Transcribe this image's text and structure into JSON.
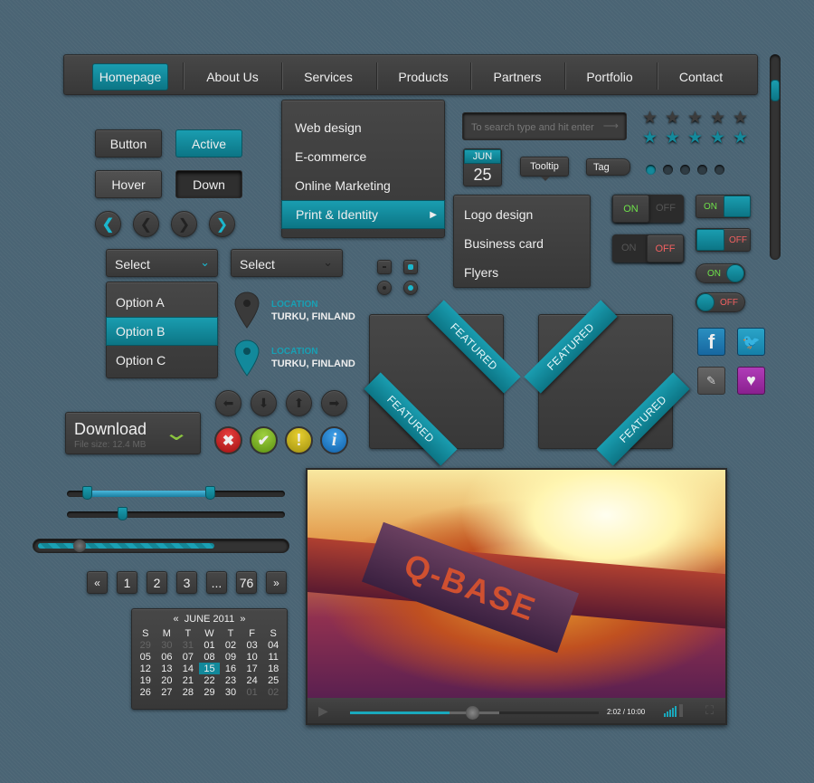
{
  "nav": {
    "items": [
      "Homepage",
      "About Us",
      "Services",
      "Products",
      "Partners",
      "Portfolio",
      "Contact"
    ],
    "active": "Homepage"
  },
  "buttons": {
    "button": "Button",
    "active": "Active",
    "hover": "Hover",
    "down": "Down"
  },
  "selects": [
    {
      "value": "Select"
    },
    {
      "value": "Select"
    }
  ],
  "options": [
    "Option A",
    "Option B",
    "Option C"
  ],
  "locations": [
    {
      "label": "LOCATION",
      "value": "TURKU, FINLAND"
    },
    {
      "label": "LOCATION",
      "value": "TURKU, FINLAND"
    }
  ],
  "menu": {
    "items": [
      "Web design",
      "E-commerce",
      "Online Marketing",
      "Print & Identity"
    ],
    "active": "Print & Identity",
    "submenu": [
      "Logo design",
      "Business card",
      "Flyers"
    ]
  },
  "search": {
    "placeholder": "To search type and hit enter"
  },
  "date": {
    "month": "JUN",
    "day": "25"
  },
  "tooltip": "Tooltip",
  "tag": "Tag",
  "toggles": {
    "on": "ON",
    "off": "OFF"
  },
  "featured": "FEATURED",
  "download": {
    "label": "Download",
    "size": "File size: 12.4 MB"
  },
  "pagination": [
    "«",
    "1",
    "2",
    "3",
    "...",
    "76",
    "»"
  ],
  "calendar": {
    "title": "JUNE 2011",
    "prev": "«",
    "next": "»",
    "days": [
      "S",
      "M",
      "T",
      "W",
      "T",
      "F",
      "S"
    ],
    "weeks": [
      [
        "29",
        "30",
        "31",
        "01",
        "02",
        "03",
        "04"
      ],
      [
        "05",
        "06",
        "07",
        "08",
        "09",
        "10",
        "11"
      ],
      [
        "12",
        "13",
        "14",
        "15",
        "16",
        "17",
        "18"
      ],
      [
        "19",
        "20",
        "21",
        "22",
        "23",
        "24",
        "25"
      ],
      [
        "26",
        "27",
        "28",
        "29",
        "30",
        "01",
        "02"
      ]
    ],
    "selected": "15"
  },
  "video": {
    "time": "2:02 / 10:00",
    "logo": "Q-BASE",
    "progress": 0.4,
    "buffered": 0.6
  },
  "ratings": {
    "dark_stars": 0,
    "teal_stars": 5
  },
  "colors": {
    "accent": "#118a9c",
    "on": "#6ee04a",
    "off": "#f06060"
  }
}
